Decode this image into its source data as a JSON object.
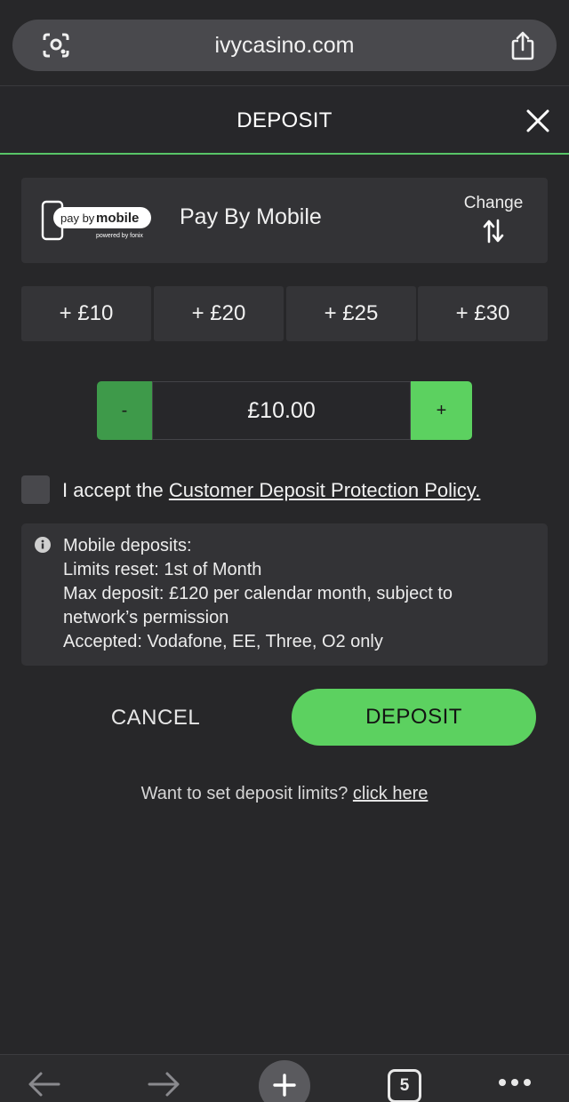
{
  "browser": {
    "url": "ivycasino.com",
    "tab_count": "5"
  },
  "header": {
    "title": "DEPOSIT"
  },
  "payment_method": {
    "logo_text": "pay by mobile",
    "logo_subtext": "powered by fonix",
    "name": "Pay By Mobile",
    "change_label": "Change"
  },
  "quick_amounts": [
    "+ £10",
    "+ £20",
    "+ £25",
    "+ £30"
  ],
  "stepper": {
    "minus_label": "-",
    "value": "£10.00",
    "plus_label": "+"
  },
  "accept": {
    "prefix": "I accept the ",
    "link_text": "Customer Deposit Protection Policy."
  },
  "info": {
    "lines": [
      "Mobile deposits:",
      "Limits reset: 1st of Month",
      "Max deposit: £120 per calendar month, subject to",
      "network’s permission",
      "Accepted: Vodafone, EE, Three, O2 only"
    ]
  },
  "actions": {
    "cancel_label": "CANCEL",
    "deposit_label": "DEPOSIT"
  },
  "limits": {
    "prefix": "Want to set deposit limits? ",
    "link_text": "click here"
  },
  "colors": {
    "background": "#272729",
    "accent_green": "#5cd160",
    "minus_green": "#3e9a4a",
    "card": "#333336"
  },
  "icons": [
    "lens-icon",
    "share-icon",
    "close-icon",
    "swap-icon",
    "info-icon",
    "back-arrow-icon",
    "forward-arrow-icon",
    "new-tab-icon",
    "tabs-icon",
    "more-icon"
  ]
}
